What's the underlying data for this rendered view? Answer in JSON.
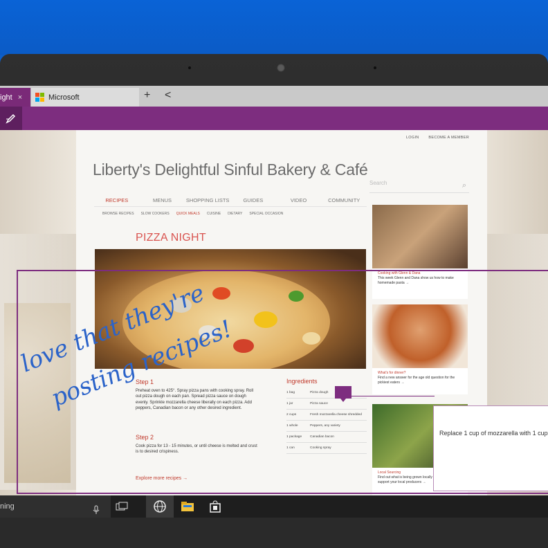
{
  "browser": {
    "active_tab_label": "ight",
    "tab2_label": "Microsoft",
    "new_tab_symbol": "+",
    "back_symbol": "<",
    "close_symbol": "×"
  },
  "site": {
    "top_links": [
      "LOGIN",
      "BECOME A MEMBER"
    ],
    "title": "Liberty's Delightful Sinful Bakery & Café",
    "search_placeholder": "Search",
    "nav": [
      "RECIPES",
      "MENUS",
      "SHOPPING LISTS",
      "GUIDES",
      "VIDEO",
      "COMMUNITY"
    ],
    "subnav": [
      "BROWSE RECIPES",
      "SLOW COOKERS",
      "QUICK MEALS",
      "CUISINE",
      "DIETARY",
      "SPECIAL OCCASION"
    ],
    "recipe_title": "PIZZA NIGHT",
    "step1_title": "Step 1",
    "step1_text": "Preheat oven to 425°. Spray pizza pans with cooking spray. Roll out pizza dough on each pan. Spread pizza sauce on dough evenly. Sprinkle mozzarella cheese liberally on each pizza. Add peppers, Canadian bacon or any other desired ingredient.",
    "step2_title": "Step 2",
    "step2_text": "Cook pizza for 13 - 15 minutes, or until cheese is melted and crust is to desired crispiness.",
    "explore_link": "Explore more recipes →",
    "ingredients_title": "Ingredients",
    "ingredients": [
      {
        "qty": "1 bag",
        "item": "Pizza dough"
      },
      {
        "qty": "1 jar",
        "item": "Pizza sauce"
      },
      {
        "qty": "2 cups",
        "item": "Fresh mozzarella cheese shredded"
      },
      {
        "qty": "1 whole",
        "item": "Peppers, any variety"
      },
      {
        "qty": "1 package",
        "item": "Canadian bacon"
      },
      {
        "qty": "1 can",
        "item": "Cooking spray"
      }
    ],
    "side_cards": [
      {
        "title": "Cooking with Glenn & Dana",
        "text": "This week Glenn and Dana show us how to make homemade pasta →"
      },
      {
        "title": "What's for dinner?",
        "text": "Find a new answer for the age old question for the pickiest eaters →"
      },
      {
        "title": "Local Sourcing",
        "text": "Find out what is being grown locally and how to support your local producers →"
      }
    ]
  },
  "ink": {
    "line1": "love that they're",
    "line2": "posting recipes!"
  },
  "comment": {
    "text": "Replace 1 cup of mozzarella with 1 cup"
  },
  "taskbar": {
    "search_text": "ning"
  },
  "colors": {
    "accent": "#7d2d7f",
    "ink_blue": "#2b63c9",
    "recipe_red": "#c0392b"
  }
}
